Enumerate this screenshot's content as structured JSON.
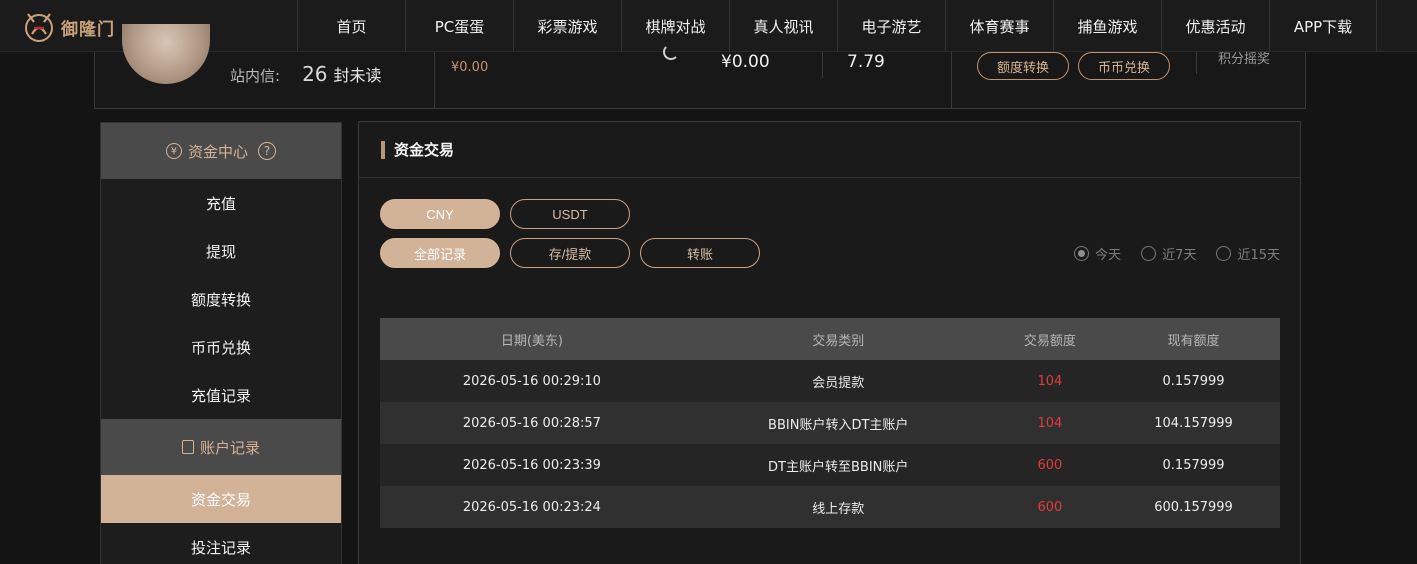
{
  "brand": {
    "logo_text": "御隆门"
  },
  "nav": {
    "items": [
      "首页",
      "PC蛋蛋",
      "彩票游戏",
      "棋牌对战",
      "真人视讯",
      "电子游艺",
      "体育赛事",
      "捕鱼游戏",
      "优惠活动",
      "APP下载"
    ]
  },
  "user": {
    "msg_label": "站内信:",
    "msg_count": "26",
    "msg_unit": "封未读",
    "balance_small": "¥0.00",
    "balance_main": "¥0.00",
    "balance_other": "7.79",
    "btn_quota_transfer": "额度转换",
    "btn_coin_exchange": "币币兑换",
    "points_label": "积分摇奖"
  },
  "sidebar": {
    "section1_title": "资金中心",
    "section1_items": [
      "充值",
      "提现",
      "额度转换",
      "币币兑换",
      "充值记录"
    ],
    "section2_title": "账户记录",
    "section2_items": [
      "资金交易",
      "投注记录"
    ],
    "active_item": "资金交易"
  },
  "panel": {
    "title": "资金交易",
    "currency_tabs": [
      "CNY",
      "USDT"
    ],
    "type_tabs": [
      "全部记录",
      "存/提款",
      "转账"
    ],
    "date_filters": [
      "今天",
      "近7天",
      "近15天"
    ],
    "selected_date_filter": "今天"
  },
  "table": {
    "headers": [
      "日期(美东)",
      "交易类别",
      "交易额度",
      "现有额度"
    ],
    "rows": [
      [
        "2026-05-16 00:29:10",
        "会员提款",
        "104",
        "0.157999"
      ],
      [
        "2026-05-16 00:28:57",
        "BBIN账户转入DT主账户",
        "104",
        "104.157999"
      ],
      [
        "2026-05-16 00:23:39",
        "DT主账户转至BBIN账户",
        "600",
        "0.157999"
      ],
      [
        "2026-05-16 00:23:24",
        "线上存款",
        "600",
        "600.157999"
      ]
    ]
  },
  "colors": {
    "accent": "#d2b397",
    "amount_red": "#e43b3b",
    "header_gray": "#4a4a4a"
  }
}
